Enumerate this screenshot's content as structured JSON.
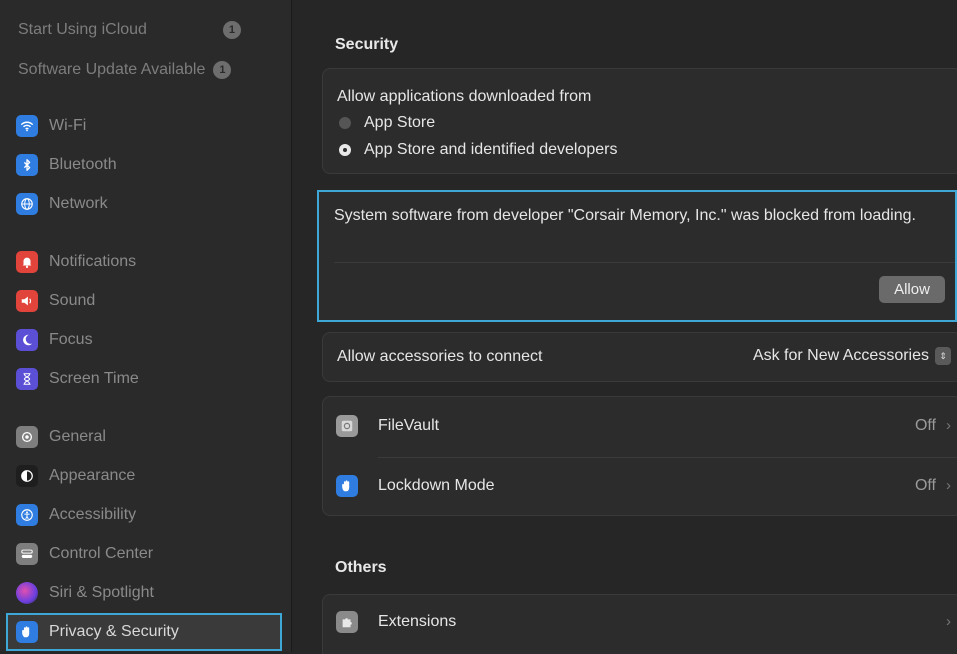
{
  "sidebar": {
    "top_items": [
      {
        "label": "Start Using iCloud",
        "badge": "1"
      },
      {
        "label": "Software Update Available",
        "badge": "1"
      }
    ],
    "items": [
      {
        "label": "Wi-Fi",
        "icon": "wifi-icon",
        "color": "#2f7de1"
      },
      {
        "label": "Bluetooth",
        "icon": "bluetooth-icon",
        "color": "#2f7de1"
      },
      {
        "label": "Network",
        "icon": "globe-icon",
        "color": "#2f7de1"
      },
      {
        "label": "Notifications",
        "icon": "bell-icon",
        "color": "#e0443b"
      },
      {
        "label": "Sound",
        "icon": "speaker-icon",
        "color": "#e0443b"
      },
      {
        "label": "Focus",
        "icon": "moon-icon",
        "color": "#5b4fd6"
      },
      {
        "label": "Screen Time",
        "icon": "hourglass-icon",
        "color": "#5b4fd6"
      },
      {
        "label": "General",
        "icon": "gear-icon",
        "color": "#7e7e7e"
      },
      {
        "label": "Appearance",
        "icon": "appearance-icon",
        "color": "#1e1e1e"
      },
      {
        "label": "Accessibility",
        "icon": "accessibility-icon",
        "color": "#2f7de1"
      },
      {
        "label": "Control Center",
        "icon": "control-center-icon",
        "color": "#7e7e7e"
      },
      {
        "label": "Siri & Spotlight",
        "icon": "siri-icon",
        "color": "#8f3fd0"
      },
      {
        "label": "Privacy & Security",
        "icon": "hand-icon",
        "color": "#2f7de1"
      }
    ]
  },
  "main": {
    "security_title": "Security",
    "allow_apps_label": "Allow applications downloaded from",
    "radio_options": [
      {
        "label": "App Store",
        "selected": false
      },
      {
        "label": "App Store and identified developers",
        "selected": true
      }
    ],
    "blocked_message": "System software from developer \"Corsair Memory, Inc.\" was blocked from loading.",
    "allow_button": "Allow",
    "accessories_label": "Allow accessories to connect",
    "accessories_value": "Ask for New Accessories",
    "filevault": {
      "label": "FileVault",
      "value": "Off"
    },
    "lockdown": {
      "label": "Lockdown Mode",
      "value": "Off"
    },
    "others_title": "Others",
    "extensions_label": "Extensions",
    "chevron": "›",
    "stepper": "⇕"
  },
  "colors": {
    "accent": "#3fa7d6",
    "background": "#262626",
    "sidebar": "#2a2a2a"
  }
}
